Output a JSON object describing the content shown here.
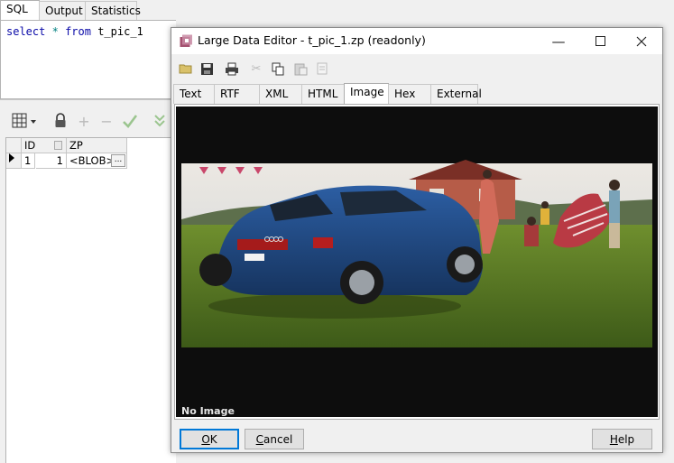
{
  "top_tabs": [
    {
      "label": "SQL",
      "active": true
    },
    {
      "label": "Output",
      "active": false
    },
    {
      "label": "Statistics",
      "active": false
    }
  ],
  "sql_editor": {
    "tokens": [
      "select",
      "*",
      "from",
      "t_pic_1"
    ]
  },
  "result_grid": {
    "columns": [
      "ID",
      "ZP"
    ],
    "rows": [
      {
        "row_num": "1",
        "id": "1",
        "zp": "<BLOB>",
        "ellipsis": "..."
      }
    ]
  },
  "dialog": {
    "title": "Large Data Editor - t_pic_1.zp (readonly)",
    "tabs": [
      {
        "label": "Text"
      },
      {
        "label": "RTF"
      },
      {
        "label": "XML"
      },
      {
        "label": "HTML"
      },
      {
        "label": "Image"
      },
      {
        "label": "Hex"
      },
      {
        "label": "External"
      }
    ],
    "active_tab": "Image",
    "viewer_status": "No Image",
    "buttons": {
      "ok_mnemonic": "O",
      "ok_rest": "K",
      "cancel_mnemonic": "C",
      "cancel_rest": "ancel",
      "help_mnemonic": "H",
      "help_rest": "elp"
    },
    "toolbar_icons": [
      "open-icon",
      "save-icon",
      "print-icon",
      "cut-icon",
      "copy-icon",
      "paste-icon",
      "select-all-icon"
    ]
  },
  "colors": {
    "accent": "#0078d7",
    "sql_keyword": "#0a0aa8",
    "viewer_background": "#0d0d0d"
  }
}
